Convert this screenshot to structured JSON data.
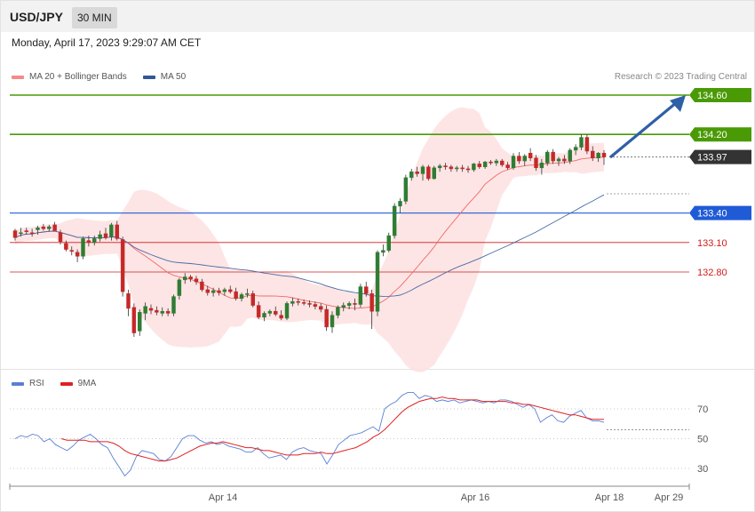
{
  "header": {
    "symbol": "USD/JPY",
    "timeframe": "30 MIN",
    "datetime": "Monday, April 17, 2023 9:29:07 AM CET"
  },
  "legend": {
    "ma20_label": "MA 20 + Bollinger Bands",
    "ma50_label": "MA 50",
    "copyright": "Research © 2023 Trading Central"
  },
  "rsi_legend": {
    "rsi_label": "RSI",
    "ma_label": "9MA"
  },
  "colors": {
    "up": "#2e7d32",
    "down": "#c62828",
    "ma20": "#f06a6a",
    "ma50": "#4a6aa8",
    "band": "#fde0e0",
    "target": "#4a9a06",
    "pivot": "#1f5bd6",
    "support": "#d11b1b",
    "current": "#333333",
    "arrow": "#2f5fa6",
    "rsi": "#5b7fd6",
    "rsi_ma": "#e02020"
  },
  "chart_data": [
    {
      "type": "candlestick",
      "title": "USD/JPY 30 MIN",
      "ylim": [
        132.5,
        134.7
      ],
      "x_ticks": [
        "Apr 14",
        "Apr 16",
        "Apr 18",
        "Apr 29"
      ],
      "levels": [
        {
          "value": 134.6,
          "label": "134.60",
          "kind": "target"
        },
        {
          "value": 134.2,
          "label": "134.20",
          "kind": "target"
        },
        {
          "value": 133.97,
          "label": "133.97",
          "kind": "current"
        },
        {
          "value": 133.4,
          "label": "133.40",
          "kind": "pivot"
        },
        {
          "value": 133.1,
          "label": "133.10",
          "kind": "support"
        },
        {
          "value": 132.8,
          "label": "132.80",
          "kind": "support"
        }
      ],
      "candles": [
        [
          133.22,
          133.24,
          133.12,
          133.15
        ],
        [
          133.2,
          133.25,
          133.16,
          133.2
        ],
        [
          133.22,
          133.25,
          133.18,
          133.21
        ],
        [
          133.2,
          133.24,
          133.16,
          133.19
        ],
        [
          133.23,
          133.27,
          133.18,
          133.25
        ],
        [
          133.26,
          133.29,
          133.22,
          133.24
        ],
        [
          133.24,
          133.28,
          133.21,
          133.26
        ],
        [
          133.28,
          133.31,
          133.23,
          133.22
        ],
        [
          133.2,
          133.23,
          133.08,
          133.11
        ],
        [
          133.09,
          133.12,
          133.01,
          133.03
        ],
        [
          133.02,
          133.06,
          132.97,
          133.01
        ],
        [
          133.0,
          133.03,
          132.9,
          132.96
        ],
        [
          132.96,
          133.16,
          132.93,
          133.14
        ],
        [
          133.12,
          133.17,
          133.06,
          133.1
        ],
        [
          133.1,
          133.17,
          133.07,
          133.14
        ],
        [
          133.14,
          133.22,
          133.11,
          133.18
        ],
        [
          133.19,
          133.25,
          133.13,
          133.15
        ],
        [
          133.16,
          133.3,
          133.12,
          133.28
        ],
        [
          133.28,
          133.32,
          133.12,
          133.14
        ],
        [
          133.13,
          133.16,
          132.55,
          132.6
        ],
        [
          132.58,
          132.62,
          132.35,
          132.43
        ],
        [
          132.44,
          132.48,
          132.14,
          132.18
        ],
        [
          132.2,
          132.42,
          132.15,
          132.39
        ],
        [
          132.38,
          132.49,
          132.31,
          132.45
        ],
        [
          132.43,
          132.47,
          132.37,
          132.41
        ],
        [
          132.41,
          132.45,
          132.36,
          132.39
        ],
        [
          132.38,
          132.44,
          132.35,
          132.4
        ],
        [
          132.4,
          132.43,
          132.35,
          132.38
        ],
        [
          132.38,
          132.57,
          132.35,
          132.55
        ],
        [
          132.56,
          132.74,
          132.52,
          132.72
        ],
        [
          132.72,
          132.79,
          132.68,
          132.75
        ],
        [
          132.75,
          132.77,
          132.7,
          132.73
        ],
        [
          132.73,
          132.76,
          132.67,
          132.7
        ],
        [
          132.7,
          132.73,
          132.6,
          132.62
        ],
        [
          132.62,
          132.66,
          132.56,
          132.59
        ],
        [
          132.59,
          132.64,
          132.55,
          132.61
        ],
        [
          132.61,
          132.64,
          132.56,
          132.59
        ],
        [
          132.6,
          132.64,
          132.56,
          132.62
        ],
        [
          132.62,
          132.66,
          132.58,
          132.6
        ],
        [
          132.6,
          132.64,
          132.51,
          132.53
        ],
        [
          132.53,
          132.59,
          132.5,
          132.57
        ],
        [
          132.57,
          132.63,
          132.54,
          132.58
        ],
        [
          132.58,
          132.61,
          132.44,
          132.46
        ],
        [
          132.46,
          132.5,
          132.32,
          132.34
        ],
        [
          132.34,
          132.4,
          132.3,
          132.38
        ],
        [
          132.38,
          132.42,
          132.35,
          132.4
        ],
        [
          132.4,
          132.45,
          132.35,
          132.37
        ],
        [
          132.36,
          132.41,
          132.31,
          132.33
        ],
        [
          132.33,
          132.5,
          132.31,
          132.48
        ],
        [
          132.48,
          132.54,
          132.45,
          132.5
        ],
        [
          132.5,
          132.53,
          132.46,
          132.49
        ],
        [
          132.49,
          132.52,
          132.46,
          132.48
        ],
        [
          132.48,
          132.51,
          132.44,
          132.47
        ],
        [
          132.47,
          132.5,
          132.42,
          132.45
        ],
        [
          132.45,
          132.48,
          132.39,
          132.42
        ],
        [
          132.42,
          132.46,
          132.2,
          132.24
        ],
        [
          132.24,
          132.4,
          132.18,
          132.36
        ],
        [
          132.36,
          132.46,
          132.33,
          132.44
        ],
        [
          132.44,
          132.49,
          132.4,
          132.46
        ],
        [
          132.46,
          132.5,
          132.42,
          132.48
        ],
        [
          132.48,
          132.53,
          132.41,
          132.47
        ],
        [
          132.47,
          132.68,
          132.44,
          132.65
        ],
        [
          132.65,
          132.7,
          132.55,
          132.58
        ],
        [
          132.58,
          132.62,
          132.22,
          132.4
        ],
        [
          132.4,
          133.02,
          132.35,
          133.0
        ],
        [
          133.0,
          133.08,
          132.96,
          133.02
        ],
        [
          133.02,
          133.2,
          133.0,
          133.17
        ],
        [
          133.17,
          133.5,
          133.14,
          133.47
        ],
        [
          133.47,
          133.55,
          133.4,
          133.52
        ],
        [
          133.52,
          133.79,
          133.49,
          133.76
        ],
        [
          133.76,
          133.85,
          133.73,
          133.82
        ],
        [
          133.82,
          133.87,
          133.77,
          133.8
        ],
        [
          133.8,
          133.89,
          133.73,
          133.87
        ],
        [
          133.87,
          133.89,
          133.73,
          133.75
        ],
        [
          133.75,
          133.88,
          133.74,
          133.86
        ],
        [
          133.86,
          133.9,
          133.82,
          133.88
        ],
        [
          133.88,
          133.91,
          133.84,
          133.87
        ],
        [
          133.87,
          133.89,
          133.82,
          133.85
        ],
        [
          133.85,
          133.88,
          133.82,
          133.86
        ],
        [
          133.86,
          133.89,
          133.82,
          133.85
        ],
        [
          133.85,
          133.88,
          133.81,
          133.84
        ],
        [
          133.84,
          133.91,
          133.82,
          133.9
        ],
        [
          133.9,
          133.93,
          133.85,
          133.87
        ],
        [
          133.87,
          133.93,
          133.85,
          133.92
        ],
        [
          133.92,
          133.94,
          133.89,
          133.91
        ],
        [
          133.91,
          133.95,
          133.88,
          133.93
        ],
        [
          133.93,
          133.95,
          133.87,
          133.89
        ],
        [
          133.89,
          133.92,
          133.84,
          133.86
        ],
        [
          133.86,
          134.01,
          133.84,
          133.98
        ],
        [
          133.98,
          134.02,
          133.9,
          133.93
        ],
        [
          133.93,
          134.0,
          133.88,
          133.98
        ],
        [
          134.01,
          134.06,
          133.93,
          133.96
        ],
        [
          133.96,
          133.99,
          133.83,
          133.86
        ],
        [
          133.86,
          133.95,
          133.79,
          133.91
        ],
        [
          133.91,
          134.04,
          133.88,
          134.02
        ],
        [
          134.02,
          134.05,
          133.9,
          133.93
        ],
        [
          133.93,
          133.97,
          133.88,
          133.95
        ],
        [
          133.95,
          133.99,
          133.9,
          133.93
        ],
        [
          133.93,
          134.06,
          133.9,
          134.04
        ],
        [
          134.04,
          134.1,
          133.99,
          134.07
        ],
        [
          134.07,
          134.2,
          134.04,
          134.17
        ],
        [
          134.17,
          134.2,
          134.0,
          134.03
        ],
        [
          134.03,
          134.08,
          133.93,
          133.96
        ],
        [
          133.96,
          134.02,
          133.92,
          134.01
        ],
        [
          134.01,
          134.04,
          133.89,
          133.97
        ]
      ],
      "series": [
        {
          "name": "MA 20",
          "kind": "ma20"
        },
        {
          "name": "MA 50",
          "kind": "ma50"
        }
      ]
    },
    {
      "type": "line",
      "levels": [
        30,
        50,
        70
      ],
      "series": [
        {
          "name": "RSI",
          "values": [
            50,
            52,
            51,
            53,
            52,
            48,
            50,
            46,
            44,
            42,
            45,
            49,
            51,
            53,
            50,
            46,
            44,
            37,
            31,
            25,
            29,
            38,
            42,
            41,
            40,
            36,
            35,
            38,
            44,
            50,
            52,
            52,
            49,
            47,
            48,
            46,
            47,
            45,
            44,
            43,
            41,
            41,
            44,
            40,
            37,
            38,
            39,
            36,
            41,
            43,
            44,
            42,
            41,
            40,
            33,
            39,
            46,
            49,
            52,
            53,
            54,
            56,
            58,
            55,
            70,
            73,
            75,
            79,
            81,
            81,
            77,
            79,
            78,
            75,
            76,
            75,
            76,
            74,
            75,
            76,
            75,
            74,
            75,
            74,
            76,
            76,
            75,
            73,
            71,
            73,
            70,
            61,
            64,
            66,
            62,
            61,
            65,
            67,
            69,
            64,
            62,
            62,
            61
          ]
        },
        {
          "name": "9MA",
          "values": [
            null,
            null,
            null,
            null,
            null,
            null,
            null,
            null,
            50,
            49,
            49,
            49,
            49,
            48,
            48,
            48,
            48,
            47,
            45,
            42,
            40,
            39,
            38,
            37,
            36,
            35,
            35,
            36,
            37,
            39,
            41,
            43,
            45,
            46,
            47,
            47,
            48,
            47,
            46,
            45,
            44,
            44,
            43,
            42,
            42,
            41,
            40,
            39,
            39,
            39,
            40,
            40,
            40,
            41,
            40,
            40,
            41,
            42,
            43,
            44,
            46,
            48,
            51,
            53,
            56,
            60,
            64,
            68,
            71,
            73,
            75,
            76,
            77,
            77,
            78,
            77,
            77,
            76,
            76,
            76,
            76,
            75,
            75,
            75,
            75,
            75,
            74,
            74,
            73,
            73,
            72,
            71,
            70,
            69,
            68,
            67,
            66,
            66,
            65,
            64,
            63,
            63,
            63
          ]
        }
      ]
    }
  ]
}
